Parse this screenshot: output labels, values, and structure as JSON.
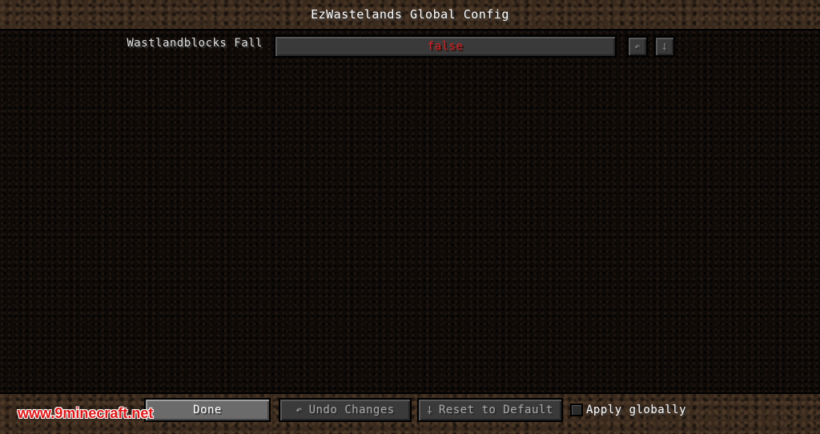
{
  "window": {
    "title": "EzWastelands Global Config"
  },
  "config_rows": [
    {
      "label": "Wastlandblocks Fall",
      "value": "false",
      "undo_icon": "undo-arrow-icon",
      "reset_icon": "reset-default-icon"
    }
  ],
  "colors": {
    "value_false": "#d02020",
    "watermark": "#e01818"
  },
  "footer": {
    "done_label": "Done",
    "undo_label": "Undo Changes",
    "undo_glyph": "↶",
    "reset_label": "Reset to Default",
    "reset_glyph": "⸸",
    "apply_globally_label": "Apply globally",
    "apply_globally_checked": false
  },
  "watermark": {
    "text": "www.9minecraft.net"
  }
}
